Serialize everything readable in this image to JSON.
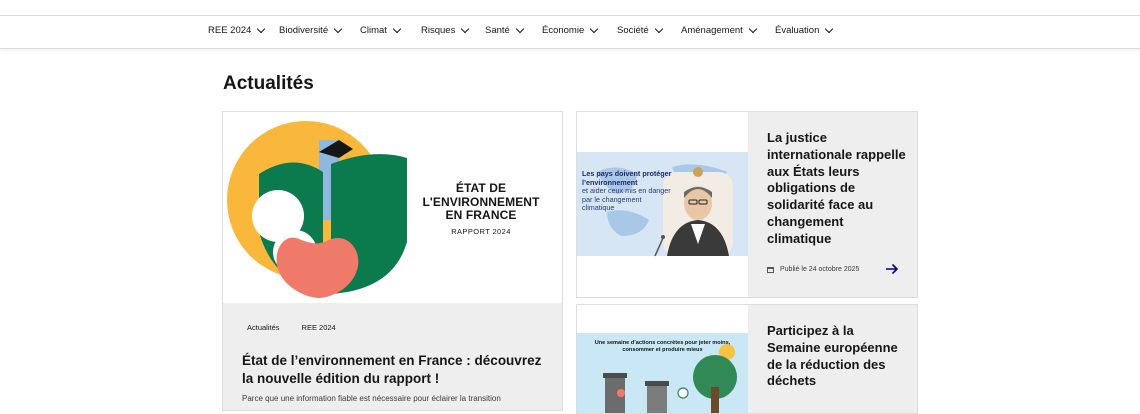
{
  "nav": {
    "items": [
      {
        "label": "REE 2024"
      },
      {
        "label": "Biodiversité"
      },
      {
        "label": "Climat"
      },
      {
        "label": "Risques"
      },
      {
        "label": "Santé"
      },
      {
        "label": "Économie"
      },
      {
        "label": "Société"
      },
      {
        "label": "Aménagement"
      },
      {
        "label": "Évaluation"
      }
    ]
  },
  "page": {
    "title": "Actualités"
  },
  "featured": {
    "logo_title": "ÉTAT DE L'ENVIRONNEMENT EN FRANCE",
    "logo_subtitle": "RAPPORT 2024",
    "tags": [
      "Actualités",
      "REE 2024"
    ],
    "title": "État de l’environnement en France : découvrez la nouvelle édition du rapport !",
    "description": "Parce que une information fiable est nécessaire pour éclairer la transition"
  },
  "cards": [
    {
      "title": "La justice internationale rappelle aux États leurs obligations de solidarité face au changement climatique",
      "date": "Publié le 24 octobre 2025",
      "banner_bold": "Les pays doivent protéger l’environnement",
      "banner_text": "et aider ceux mis en danger par le changement climatique"
    },
    {
      "title": "Participez à la Semaine européenne de la réduction des déchets",
      "image_text": "Une semaine d’actions concrètes pour jeter moins, consommer et produire mieux"
    }
  ],
  "colors": {
    "accent": "#000091",
    "card_bg": "#eeeeee",
    "border": "#dddddd"
  }
}
